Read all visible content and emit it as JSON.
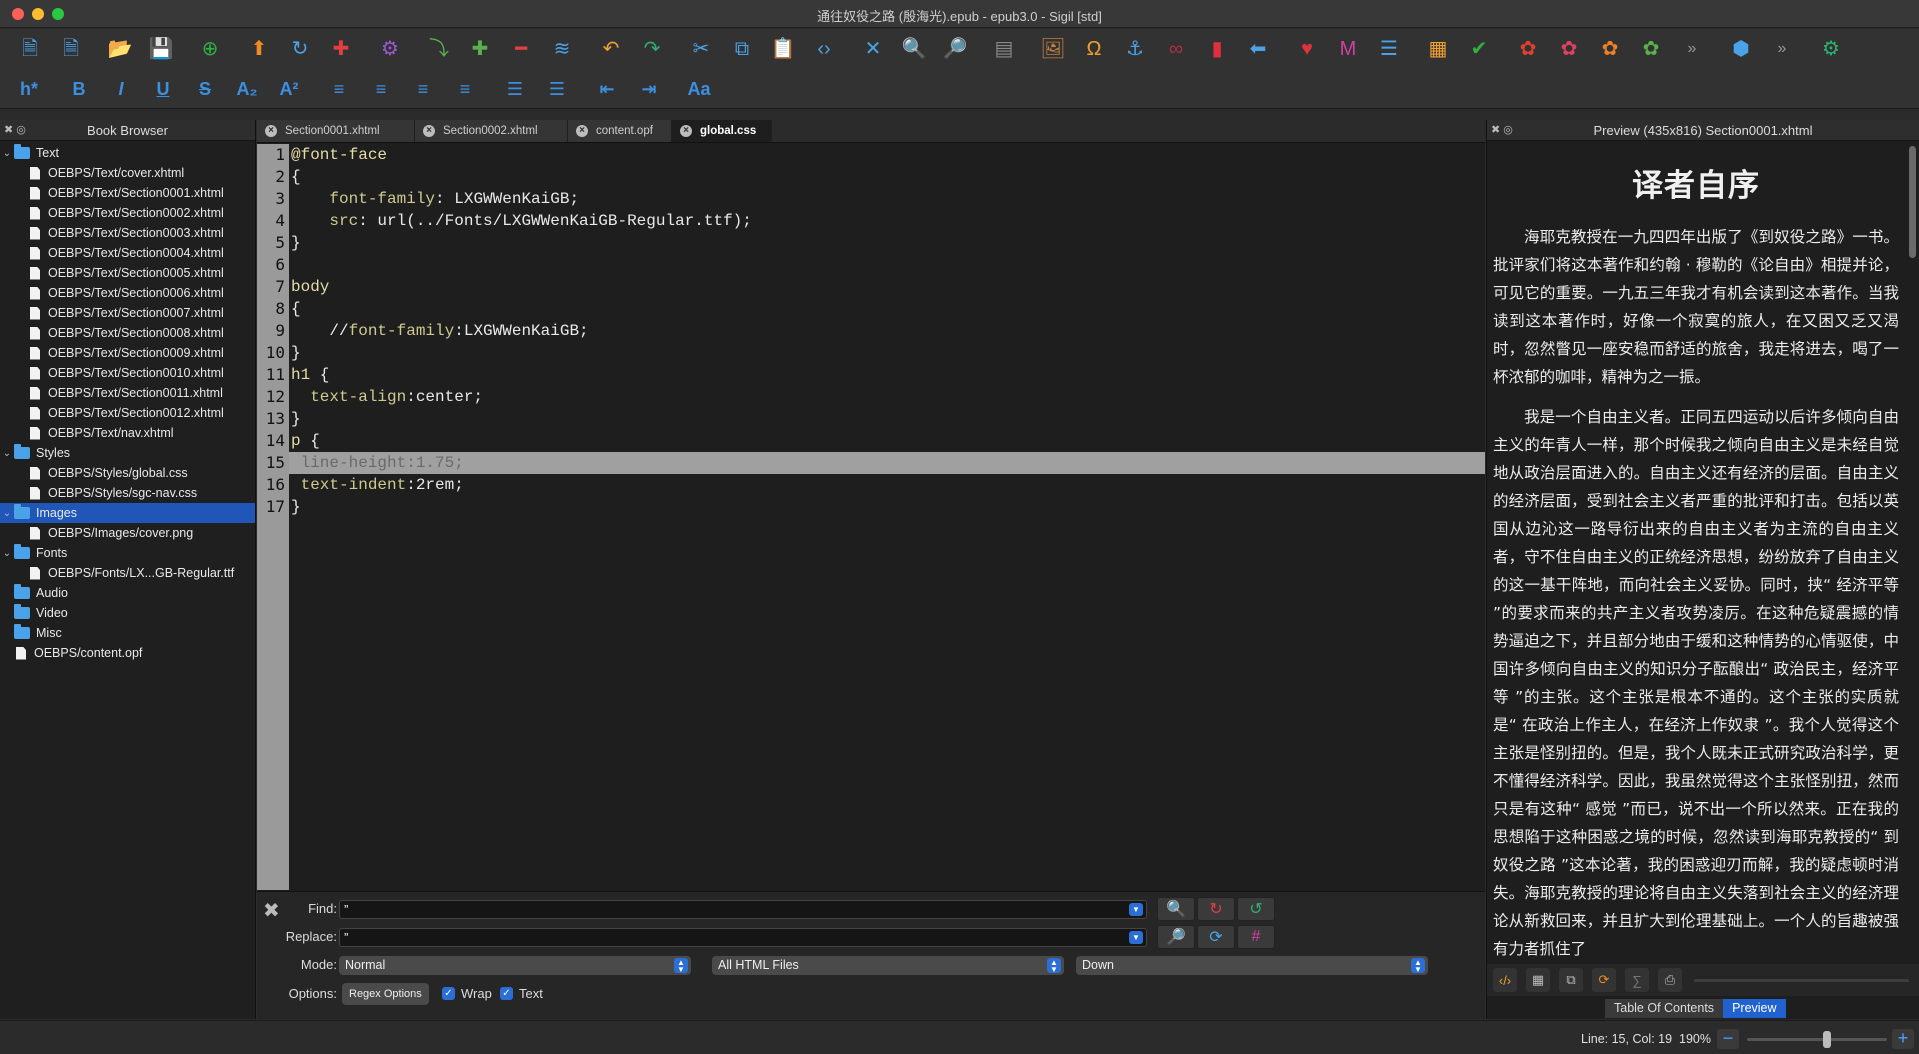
{
  "window": {
    "title": "通往奴役之路 (殷海光).epub - epub3.0 - Sigil [std]"
  },
  "toolbar_main": [
    {
      "name": "new-html-icon",
      "glyph": "🗎",
      "color": "#4aa3e8"
    },
    {
      "name": "add-file-icon",
      "glyph": "🗎",
      "color": "#4aa3e8"
    },
    {
      "name": "open-folder-icon",
      "glyph": "📂",
      "color": "#f0a030"
    },
    {
      "name": "save-icon",
      "glyph": "💾",
      "color": "#e04040"
    },
    {
      "name": "add-existing-icon",
      "glyph": "⊕",
      "color": "#30b040"
    },
    {
      "name": "move-up-icon",
      "glyph": "⬆",
      "color": "#f08a24"
    },
    {
      "name": "refresh-icon",
      "glyph": "↻",
      "color": "#4aa3e8"
    },
    {
      "name": "split-icon",
      "glyph": "✚",
      "color": "#e04040"
    },
    {
      "name": "settings-gear-icon",
      "glyph": "⚙",
      "color": "#9b59d0"
    },
    {
      "name": "insert-before-icon",
      "glyph": "⤵",
      "color": "#5ab04a"
    },
    {
      "name": "insert-after-icon",
      "glyph": "✚",
      "color": "#5ab04a"
    },
    {
      "name": "remove-icon",
      "glyph": "━",
      "color": "#e04040"
    },
    {
      "name": "merge-icon",
      "glyph": "≋",
      "color": "#4aa3e8"
    },
    {
      "name": "undo-icon",
      "glyph": "↶",
      "color": "#f0a030"
    },
    {
      "name": "redo-icon",
      "glyph": "↷",
      "color": "#30b070"
    },
    {
      "name": "cut-icon",
      "glyph": "✂",
      "color": "#4aa3e8"
    },
    {
      "name": "copy-icon",
      "glyph": "⧉",
      "color": "#4aa3e8"
    },
    {
      "name": "paste-icon",
      "glyph": "📋",
      "color": "#4aa3e8"
    },
    {
      "name": "link-code-icon",
      "glyph": "‹›",
      "color": "#4aa3e8"
    },
    {
      "name": "x-tool-icon",
      "glyph": "✕",
      "color": "#4aa3e8"
    },
    {
      "name": "search-icon",
      "glyph": "🔍",
      "color": "#4aa3e8"
    },
    {
      "name": "search-advanced-icon",
      "glyph": "🔎",
      "color": "#4aa3e8"
    },
    {
      "name": "cabinet-icon",
      "glyph": "▤",
      "color": "#8a8a8a"
    },
    {
      "name": "insert-image-icon",
      "glyph": "🖼",
      "color": "#c08040"
    },
    {
      "name": "insert-special-char-icon",
      "glyph": "Ω",
      "color": "#f0a030"
    },
    {
      "name": "anchor-icon",
      "glyph": "⚓",
      "color": "#4aa3e8"
    },
    {
      "name": "link-icon",
      "glyph": "∞",
      "color": "#b03040"
    },
    {
      "name": "bookmark-icon",
      "glyph": "▮",
      "color": "#e03040"
    },
    {
      "name": "back-arrow-icon",
      "glyph": "⬅",
      "color": "#4aa3e8"
    },
    {
      "name": "heart-icon",
      "glyph": "♥",
      "color": "#e03040"
    },
    {
      "name": "metadata-icon",
      "glyph": "M",
      "color": "#d040a0"
    },
    {
      "name": "toc-icon",
      "glyph": "☰",
      "color": "#4aa3e8"
    },
    {
      "name": "generate-toc-icon",
      "glyph": "▦",
      "color": "#f0a030"
    },
    {
      "name": "spellcheck-icon",
      "glyph": "✔",
      "color": "#30b040"
    },
    {
      "name": "plugin-1-icon",
      "glyph": "✿",
      "color": "#e04030"
    },
    {
      "name": "plugin-2-icon",
      "glyph": "✿",
      "color": "#e04060"
    },
    {
      "name": "plugin-3-icon",
      "glyph": "✿",
      "color": "#f08024"
    },
    {
      "name": "plugin-green-icon",
      "glyph": "✿",
      "color": "#5ab04a"
    },
    {
      "name": "overflow-chevron-icon",
      "glyph": "»",
      "color": "#999999"
    },
    {
      "name": "plugin-6-icon",
      "glyph": "⬢",
      "color": "#4aa3e8"
    },
    {
      "name": "overflow-chevron-2-icon",
      "glyph": "»",
      "color": "#999999"
    },
    {
      "name": "plugin-check-icon",
      "glyph": "⚙",
      "color": "#30b070"
    }
  ],
  "toolbar_format": [
    {
      "name": "heading-icon",
      "label": "h*"
    },
    {
      "name": "bold-icon",
      "label": "B"
    },
    {
      "name": "italic-icon",
      "label": "I"
    },
    {
      "name": "underline-icon",
      "label": "U"
    },
    {
      "name": "strikethrough-icon",
      "label": "S"
    },
    {
      "name": "subscript-icon",
      "label": "A₂"
    },
    {
      "name": "superscript-icon",
      "label": "A²"
    },
    {
      "name": "align-left-icon",
      "label": "≡"
    },
    {
      "name": "align-center-icon",
      "label": "≡"
    },
    {
      "name": "align-right-icon",
      "label": "≡"
    },
    {
      "name": "align-justify-icon",
      "label": "≡"
    },
    {
      "name": "bullet-list-icon",
      "label": "☰"
    },
    {
      "name": "numbered-list-icon",
      "label": "☰"
    },
    {
      "name": "decrease-indent-icon",
      "label": "⇤"
    },
    {
      "name": "increase-indent-icon",
      "label": "⇥"
    },
    {
      "name": "text-case-icon",
      "label": "Aa"
    }
  ],
  "book_browser": {
    "title": "Book Browser",
    "items": [
      {
        "type": "folder",
        "level": 1,
        "label": "Text",
        "expanded": true
      },
      {
        "type": "file",
        "level": 2,
        "label": "OEBPS/Text/cover.xhtml"
      },
      {
        "type": "file",
        "level": 2,
        "label": "OEBPS/Text/Section0001.xhtml"
      },
      {
        "type": "file",
        "level": 2,
        "label": "OEBPS/Text/Section0002.xhtml"
      },
      {
        "type": "file",
        "level": 2,
        "label": "OEBPS/Text/Section0003.xhtml"
      },
      {
        "type": "file",
        "level": 2,
        "label": "OEBPS/Text/Section0004.xhtml"
      },
      {
        "type": "file",
        "level": 2,
        "label": "OEBPS/Text/Section0005.xhtml"
      },
      {
        "type": "file",
        "level": 2,
        "label": "OEBPS/Text/Section0006.xhtml"
      },
      {
        "type": "file",
        "level": 2,
        "label": "OEBPS/Text/Section0007.xhtml"
      },
      {
        "type": "file",
        "level": 2,
        "label": "OEBPS/Text/Section0008.xhtml"
      },
      {
        "type": "file",
        "level": 2,
        "label": "OEBPS/Text/Section0009.xhtml"
      },
      {
        "type": "file",
        "level": 2,
        "label": "OEBPS/Text/Section0010.xhtml"
      },
      {
        "type": "file",
        "level": 2,
        "label": "OEBPS/Text/Section0011.xhtml"
      },
      {
        "type": "file",
        "level": 2,
        "label": "OEBPS/Text/Section0012.xhtml"
      },
      {
        "type": "file",
        "level": 2,
        "label": "OEBPS/Text/nav.xhtml"
      },
      {
        "type": "folder",
        "level": 1,
        "label": "Styles",
        "expanded": true
      },
      {
        "type": "file",
        "level": 2,
        "label": "OEBPS/Styles/global.css"
      },
      {
        "type": "file",
        "level": 2,
        "label": "OEBPS/Styles/sgc-nav.css"
      },
      {
        "type": "folder",
        "level": 1,
        "label": "Images",
        "expanded": true,
        "selected": true
      },
      {
        "type": "file",
        "level": 2,
        "label": "OEBPS/Images/cover.png"
      },
      {
        "type": "folder",
        "level": 1,
        "label": "Fonts",
        "expanded": true
      },
      {
        "type": "file",
        "level": 2,
        "label": "OEBPS/Fonts/LX...GB-Regular.ttf"
      },
      {
        "type": "folder",
        "level": 1,
        "label": "Audio",
        "expanded": false
      },
      {
        "type": "folder",
        "level": 1,
        "label": "Video",
        "expanded": false
      },
      {
        "type": "folder",
        "level": 1,
        "label": "Misc",
        "expanded": false
      },
      {
        "type": "file",
        "level": 1,
        "label": "OEBPS/content.opf"
      }
    ]
  },
  "editor": {
    "tabs": [
      {
        "label": "Section0001.xhtml",
        "active": false
      },
      {
        "label": "Section0002.xhtml",
        "active": false
      },
      {
        "label": "content.opf",
        "active": false
      },
      {
        "label": "global.css",
        "active": true
      }
    ],
    "highlighted_line": 15,
    "lines": [
      [
        {
          "t": "@font-face",
          "c": "kw"
        }
      ],
      [
        {
          "t": "{",
          "c": "val"
        }
      ],
      [
        {
          "t": "    font-family",
          "c": "prop"
        },
        {
          "t": ": LXGWWenKaiGB;",
          "c": "val"
        }
      ],
      [
        {
          "t": "    src",
          "c": "prop"
        },
        {
          "t": ": url(../Fonts/LXGWWenKaiGB-Regular.ttf);",
          "c": "val"
        }
      ],
      [
        {
          "t": "}",
          "c": "val"
        }
      ],
      [
        {
          "t": "",
          "c": "val"
        }
      ],
      [
        {
          "t": "body",
          "c": "kw"
        }
      ],
      [
        {
          "t": "{",
          "c": "val"
        }
      ],
      [
        {
          "t": "    //",
          "c": "val"
        },
        {
          "t": "font-family",
          "c": "prop"
        },
        {
          "t": ":LXGWWenKaiGB;",
          "c": "val"
        }
      ],
      [
        {
          "t": "}",
          "c": "val"
        }
      ],
      [
        {
          "t": "h1",
          "c": "kw"
        },
        {
          "t": " {",
          "c": "val"
        }
      ],
      [
        {
          "t": "  text-align",
          "c": "prop"
        },
        {
          "t": ":center;",
          "c": "val"
        }
      ],
      [
        {
          "t": "}",
          "c": "val"
        }
      ],
      [
        {
          "t": "p",
          "c": "kw"
        },
        {
          "t": " {",
          "c": "val"
        }
      ],
      [
        {
          "t": " line-height",
          "c": "prop"
        },
        {
          "t": ":1.75;",
          "c": "val"
        }
      ],
      [
        {
          "t": " text-indent",
          "c": "prop"
        },
        {
          "t": ":2rem;",
          "c": "val"
        }
      ],
      [
        {
          "t": "}",
          "c": "val"
        }
      ]
    ]
  },
  "find": {
    "find_label": "Find:",
    "find_value": "”",
    "replace_label": "Replace:",
    "replace_value": "”",
    "mode_label": "Mode:",
    "mode_value": "Normal",
    "scope_value": "All HTML Files",
    "direction_value": "Down",
    "options_label": "Options:",
    "regex_button": "Regex Options",
    "wrap_label": "Wrap",
    "wrap_checked": true,
    "text_label": "Text",
    "text_checked": true
  },
  "preview": {
    "header": "Preview (435x816) Section0001.xhtml",
    "title": "译者自序",
    "paragraphs": [
      "海耶克教授在一九四四年出版了《到奴役之路》一书。批评家们将这本著作和约翰 · 穆勒的《论自由》相提并论，可见它的重要。一九五三年我才有机会读到这本著作。当我读到这本著作时，好像一个寂寞的旅人，在又困又乏又渴时，忽然瞥见一座安稳而舒适的旅舍，我走将进去，喝了一杯浓郁的咖啡，精神为之一振。",
      "我是一个自由主义者。正同五四运动以后许多倾向自由主义的年青人一样，那个时候我之倾向自由主义是未经自觉地从政治层面进入的。自由主义还有经济的层面。自由主义的经济层面，受到社会主义者严重的批评和打击。包括以英国从边沁这一路导衍出来的自由主义者为主流的自由主义者，守不住自由主义的正统经济思想，纷纷放弃了自由主义的这一基干阵地，而向社会主义妥协。同时，挟“ 经济平等 ”的要求而来的共产主义者攻势凌厉。在这种危疑震撼的情势逼迫之下，并且部分地由于缓和这种情势的心情驱使，中国许多倾向自由主义的知识分子酝酿出“ 政治民主，经济平等 ”的主张。这个主张是根本不通的。这个主张的实质就是“ 在政治上作主人，在经济上作奴隶 ”。我个人觉得这个主张是怪别扭的。但是，我个人既未正式研究政治科学，更不懂得经济科学。因此，我虽然觉得这个主张怪别扭，然而只是有这种“ 感觉 ”而已，说不出一个所以然来。正在我的思想陷于这种困惑之境的时候，忽然读到海耶克教授的“ 到奴役之路 ”这本论著，我的困惑迎刃而解，我的疑虑顿时消失。海耶克教授的理论将自由主义失落到社会主义的经济理论从新救回来，并且扩大到伦理基础上。一个人的旨趣被强有力者抓住了"
    ],
    "tabs": [
      {
        "label": "Table Of Contents",
        "active": false
      },
      {
        "label": "Preview",
        "active": true
      }
    ]
  },
  "status": {
    "position": "Line: 15, Col: 19",
    "zoom": "190%"
  }
}
